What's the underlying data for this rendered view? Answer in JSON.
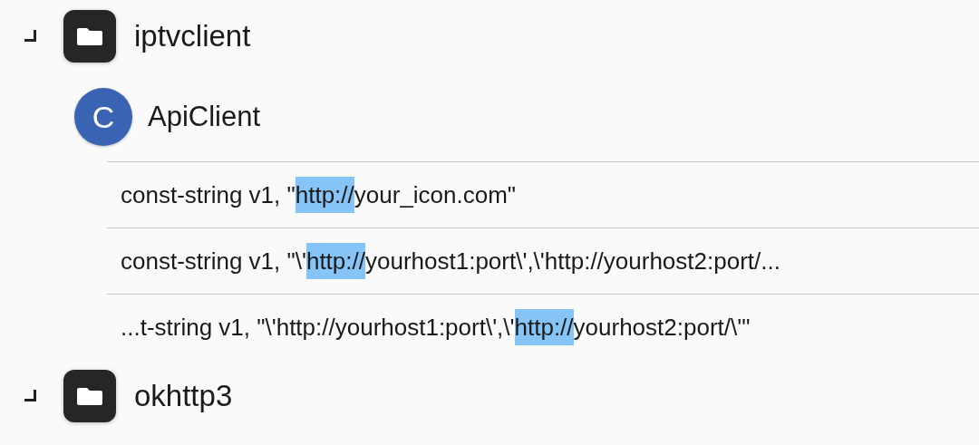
{
  "tree": [
    {
      "name": "iptvclient",
      "kind": "package",
      "expanded": true,
      "children": [
        {
          "name": "ApiClient",
          "kind": "class",
          "badge": "C",
          "matches": [
            {
              "before": "const-string v1, \"",
              "match": "http://",
              "after": "your_icon.com\""
            },
            {
              "before": "const-string v1, \"\\'",
              "match": "http://",
              "after": "yourhost1:port\\',\\'http://yourhost2:port/..."
            },
            {
              "before": "...t-string v1, \"\\'http://yourhost1:port\\',\\'",
              "match": "http://",
              "after": "yourhost2:port/\\'\""
            }
          ]
        }
      ]
    },
    {
      "name": "okhttp3",
      "kind": "package",
      "expanded": true
    }
  ]
}
